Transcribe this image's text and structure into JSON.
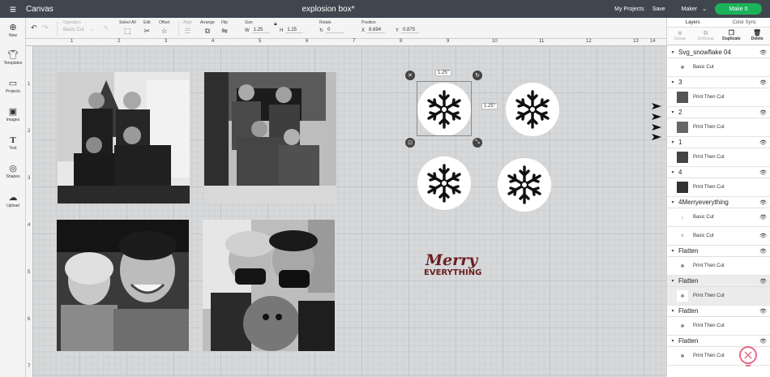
{
  "topbar": {
    "menu_icon": "hamburger-icon",
    "app_title": "Canvas",
    "doc_title": "explosion box*",
    "my_projects": "My Projects",
    "save": "Save",
    "machine": "Maker",
    "make_it": "Make It",
    "accent": "#1bb35a"
  },
  "toolbar": {
    "undo_icon": "undo-icon",
    "redo_icon": "redo-icon",
    "operation_label": "Operation",
    "operation_value": "Basic Cut",
    "select_all": "Select All",
    "edit": "Edit",
    "offset": "Offset",
    "align": "Align",
    "arrange": "Arrange",
    "flip": "Flip",
    "size": "Size",
    "size_w_label": "W",
    "size_w": "1.25",
    "size_h_label": "H",
    "size_h": "1.25",
    "rotate": "Rotate",
    "rotate_value": "0",
    "position": "Position",
    "pos_x_label": "X",
    "pos_x": "8.694",
    "pos_y_label": "Y",
    "pos_y": "0.875"
  },
  "sidebar": {
    "items": [
      {
        "label": "New",
        "icon": "plus-icon"
      },
      {
        "label": "Templates",
        "icon": "shirt-icon"
      },
      {
        "label": "Projects",
        "icon": "book-icon"
      },
      {
        "label": "Images",
        "icon": "image-icon"
      },
      {
        "label": "Text",
        "icon": "text-icon"
      },
      {
        "label": "Shapes",
        "icon": "shapes-icon"
      },
      {
        "label": "Upload",
        "icon": "upload-icon"
      }
    ]
  },
  "rulers": {
    "top": [
      "1",
      "2",
      "3",
      "4",
      "5",
      "6",
      "7",
      "8",
      "9",
      "10",
      "11",
      "12",
      "13",
      "14"
    ],
    "left": [
      "1",
      "2",
      "3",
      "4",
      "5",
      "6",
      "7"
    ]
  },
  "canvas": {
    "dim_width": "1.25\"",
    "dim_height": "1.25\"",
    "merry_text_top": "Merry",
    "merry_text_bottom": "EVERYTHING"
  },
  "panel": {
    "tabs": [
      "Layers",
      "Color Sync"
    ],
    "actions": [
      {
        "label": "Group",
        "icon": "group-icon",
        "enabled": false
      },
      {
        "label": "UnGroup",
        "icon": "ungroup-icon",
        "enabled": false
      },
      {
        "label": "Duplicate",
        "icon": "duplicate-icon",
        "enabled": true
      },
      {
        "label": "Delete",
        "icon": "trash-icon",
        "enabled": true
      }
    ],
    "layers": [
      {
        "group": "Svg_snowflake 04",
        "items": [
          {
            "label": "Basic Cut",
            "thumb": "snowflake"
          }
        ]
      },
      {
        "group": "3",
        "items": [
          {
            "label": "Print Then Cut",
            "thumb": "photo"
          }
        ]
      },
      {
        "group": "2",
        "items": [
          {
            "label": "Print Then Cut",
            "thumb": "photo"
          }
        ]
      },
      {
        "group": "1",
        "items": [
          {
            "label": "Print Then Cut",
            "thumb": "photo"
          }
        ]
      },
      {
        "group": "4",
        "items": [
          {
            "label": "Print Then Cut",
            "thumb": "photo"
          }
        ]
      },
      {
        "group": "4Merryeverything",
        "items": [
          {
            "label": "Basic Cut",
            "thumb": "text"
          },
          {
            "label": "Basic Cut",
            "thumb": "red-text"
          }
        ]
      },
      {
        "group": "Flatten",
        "items": [
          {
            "label": "Print Then Cut",
            "thumb": "snowflake"
          }
        ]
      },
      {
        "group": "Flatten",
        "items": [
          {
            "label": "Print Then Cut",
            "thumb": "snowflake"
          }
        ],
        "highlight": true
      },
      {
        "group": "Flatten",
        "items": [
          {
            "label": "Print Then Cut",
            "thumb": "snowflake"
          }
        ]
      },
      {
        "group": "Flatten",
        "items": [
          {
            "label": "Print Then Cut",
            "thumb": "snowflake"
          }
        ]
      }
    ]
  }
}
